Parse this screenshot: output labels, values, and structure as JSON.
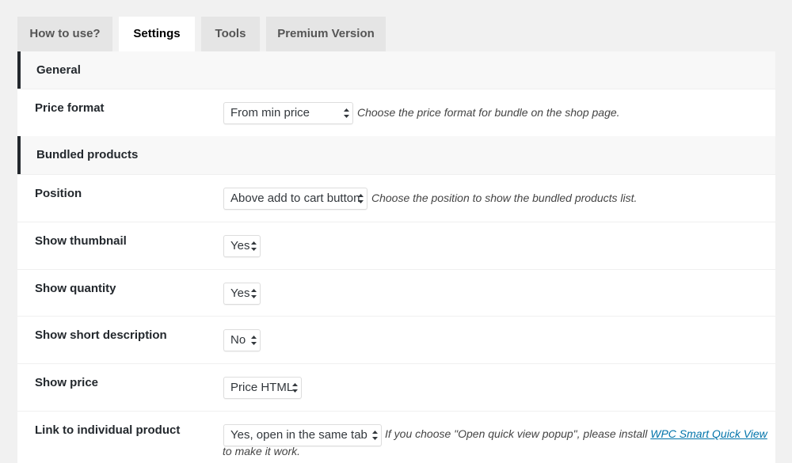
{
  "tabs": [
    {
      "label": "How to use?",
      "active": false
    },
    {
      "label": "Settings",
      "active": true
    },
    {
      "label": "Tools",
      "active": false
    },
    {
      "label": "Premium Version",
      "active": false
    }
  ],
  "sections": {
    "general": "General",
    "bundled": "Bundled products"
  },
  "rows": {
    "price_format": {
      "label": "Price format",
      "value": "From min price",
      "description": "Choose the price format for bundle on the shop page."
    },
    "position": {
      "label": "Position",
      "value": "Above add to cart button",
      "description": "Choose the position to show the bundled products list."
    },
    "show_thumbnail": {
      "label": "Show thumbnail",
      "value": "Yes"
    },
    "show_quantity": {
      "label": "Show quantity",
      "value": "Yes"
    },
    "show_short_description": {
      "label": "Show short description",
      "value": "No"
    },
    "show_price": {
      "label": "Show price",
      "value": "Price HTML"
    },
    "link_individual": {
      "label": "Link to individual product",
      "value": "Yes, open in the same tab",
      "description_prefix": "If you choose \"Open quick view popup\", please install ",
      "description_link": "WPC Smart Quick View",
      "description_suffix": " to make it work."
    }
  },
  "colors": {
    "link": "#0073aa",
    "section_border": "#23282d",
    "tab_inactive_bg": "#e5e5e5"
  }
}
